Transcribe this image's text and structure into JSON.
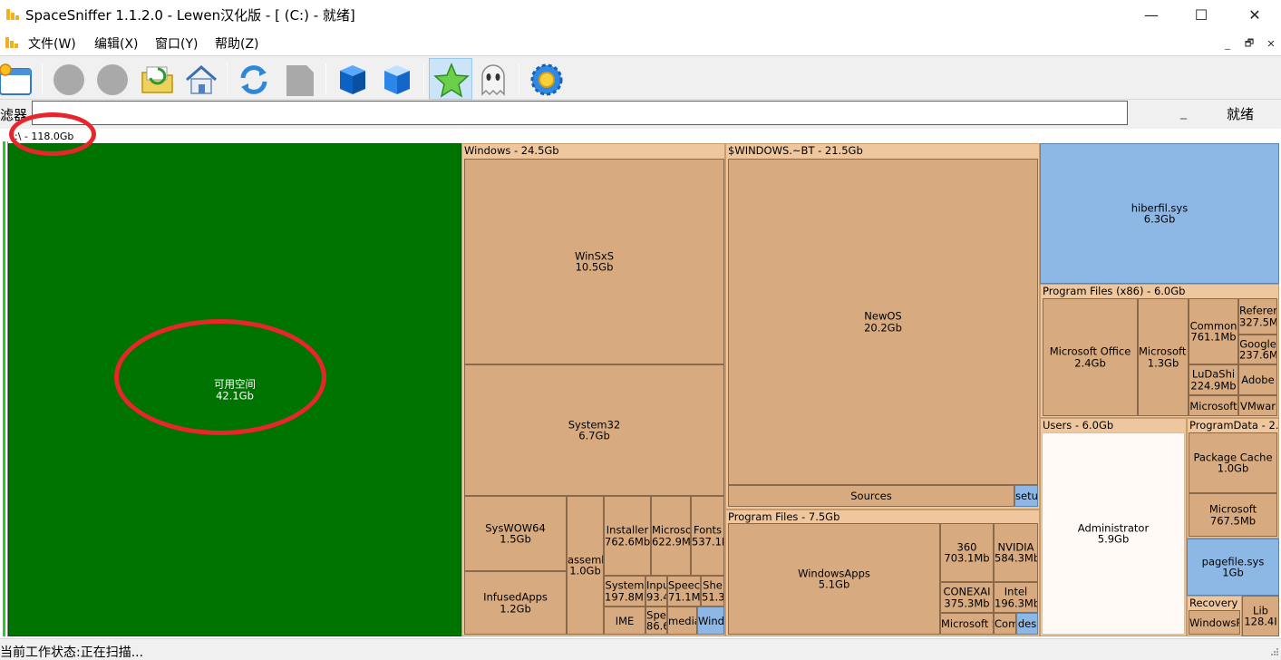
{
  "window": {
    "title": "SpaceSniffer 1.1.2.0 - Lewen汉化版 - [ (C:) - 就绪]",
    "minimize": "—",
    "maximize": "☐",
    "close": "✕"
  },
  "menu": {
    "items": [
      "文件(W)",
      "编辑(X)",
      "窗口(Y)",
      "帮助(Z)"
    ],
    "mdi": [
      "_",
      "🗗",
      "✕"
    ]
  },
  "toolbar": {
    "buttons": [
      "new-window",
      "disabled-1",
      "disabled-2",
      "open-folder",
      "home",
      "refresh",
      "disabled-page",
      "cube-dark",
      "cube-light",
      "star",
      "ghost",
      "settings-gear"
    ]
  },
  "filter": {
    "label": "滤器",
    "value": "",
    "underscore": "_",
    "status": "就绪"
  },
  "map": {
    "root_label": ":\\ - 118.0Gb",
    "free": {
      "name": "可用空间",
      "size": "42.1Gb"
    },
    "windows": {
      "header": "Windows - 24.5Gb",
      "winsxs": "WinSxS\n10.5Gb",
      "system32": "System32\n6.7Gb",
      "syswow64": "SysWOW64\n1.5Gb",
      "infusedapps": "InfusedApps\n1.2Gb",
      "assembly": "assemb\n1.0Gb",
      "installer": "Installer\n762.6Mb",
      "microsoft": "Microsoi\n622.9M",
      "fonts": "Fonts\n537.1N",
      "systemapps": "System\n197.8Mb",
      "inputmethod": "Inpu\n93.4",
      "speech": "Speec\n71.1M",
      "shell": "She\n51.3",
      "ime": "IME",
      "speech2": "Spe\n86.6",
      "media": "media",
      "wind": "Wind"
    },
    "bt": {
      "header": "$WINDOWS.~BT - 21.5Gb",
      "newos": "NewOS\n20.2Gb",
      "sources": "Sources",
      "setup": "setu"
    },
    "programfiles": {
      "header": "Program Files - 7.5Gb",
      "windowsapps": "WindowsApps\n5.1Gb",
      "p360": "360\n703.1Mb",
      "nvidia": "NVIDIA\n584.3Mb",
      "conexant": "CONEXAI\n375.3Mb",
      "intel": "Intel\n196.3Mb",
      "microsoft": "Microsoft S",
      "common": "Com",
      "desktop": "des"
    },
    "hiberfil": "hiberfil.sys\n6.3Gb",
    "pfx86": {
      "header": "Program Files (x86) - 6.0Gb",
      "office": "Microsoft Office\n2.4Gb",
      "microsoftv": "Microsoft V\n1.3Gb",
      "common": "Common\n761.1Mb",
      "reference": "Referer\n327.5M",
      "google": "Google\n237.6M",
      "ludashi": "LuDaShi\n224.9Mb",
      "adobe": "Adobe",
      "microsoft": "Microsoft",
      "vmware": "VMwar"
    },
    "users": {
      "header": "Users - 6.0Gb",
      "administrator": "Administrator\n5.9Gb"
    },
    "programdata": {
      "header": "ProgramData - 2.0",
      "packagecache": "Package Cache\n1.0Gb",
      "microsoft": "Microsoft\n767.5Mb"
    },
    "pagefile": "pagefile.sys\n1Gb",
    "recovery": {
      "header": "Recovery -",
      "windowsre": "WindowsR"
    },
    "lib": "Lib\n128.4I"
  },
  "status": {
    "text": "当前工作状态:正在扫描..."
  },
  "colors": {
    "free_space": "#007400",
    "folder_tile": "#d8aa7f",
    "folder_header": "#efc79f",
    "file_tile": "#8db8e5",
    "annotation": "#e8252a"
  }
}
